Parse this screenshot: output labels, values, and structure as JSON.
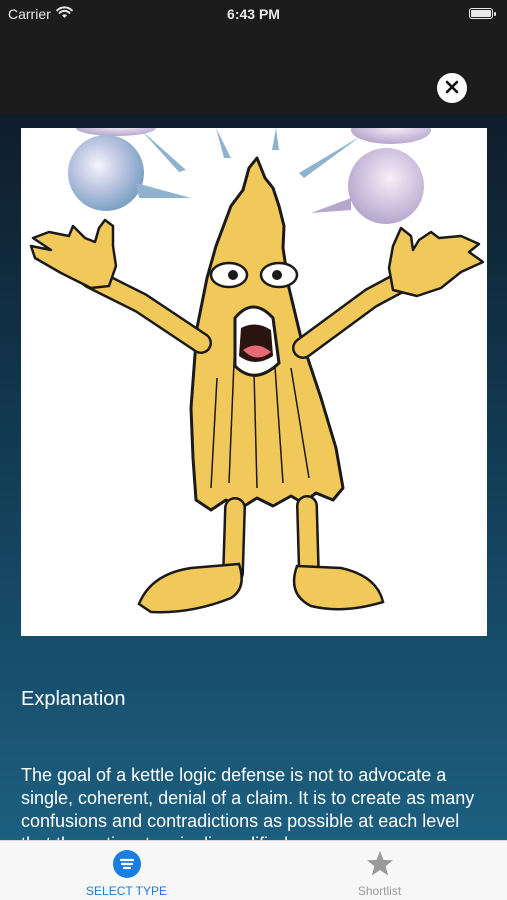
{
  "status_bar": {
    "carrier": "Carrier",
    "time": "6:43 PM",
    "wifi_icon": "wifi-icon",
    "battery_icon": "battery-icon"
  },
  "header": {
    "close_icon": "close-icon"
  },
  "illustration": {
    "description_icon": "kettle-character-illustration"
  },
  "explanation": {
    "title": "Explanation",
    "text": "The goal of a kettle logic defense is not to advocate a single, coherent, denial of a claim. It is to create as many confusions and contradictions as possible at each level that the entire story is disqualified..."
  },
  "tabbar": {
    "tabs": [
      {
        "label": "SELECT TYPE",
        "icon": "list-icon",
        "selected": true
      },
      {
        "label": "Shortlist",
        "icon": "star-icon",
        "selected": false
      }
    ]
  },
  "colors": {
    "accent": "#1a7de0",
    "header_bg": "#1c1c1c",
    "gradient_top": "#0f1d2b",
    "gradient_bottom": "#1c5f80",
    "character_fill": "#f0c95a"
  }
}
